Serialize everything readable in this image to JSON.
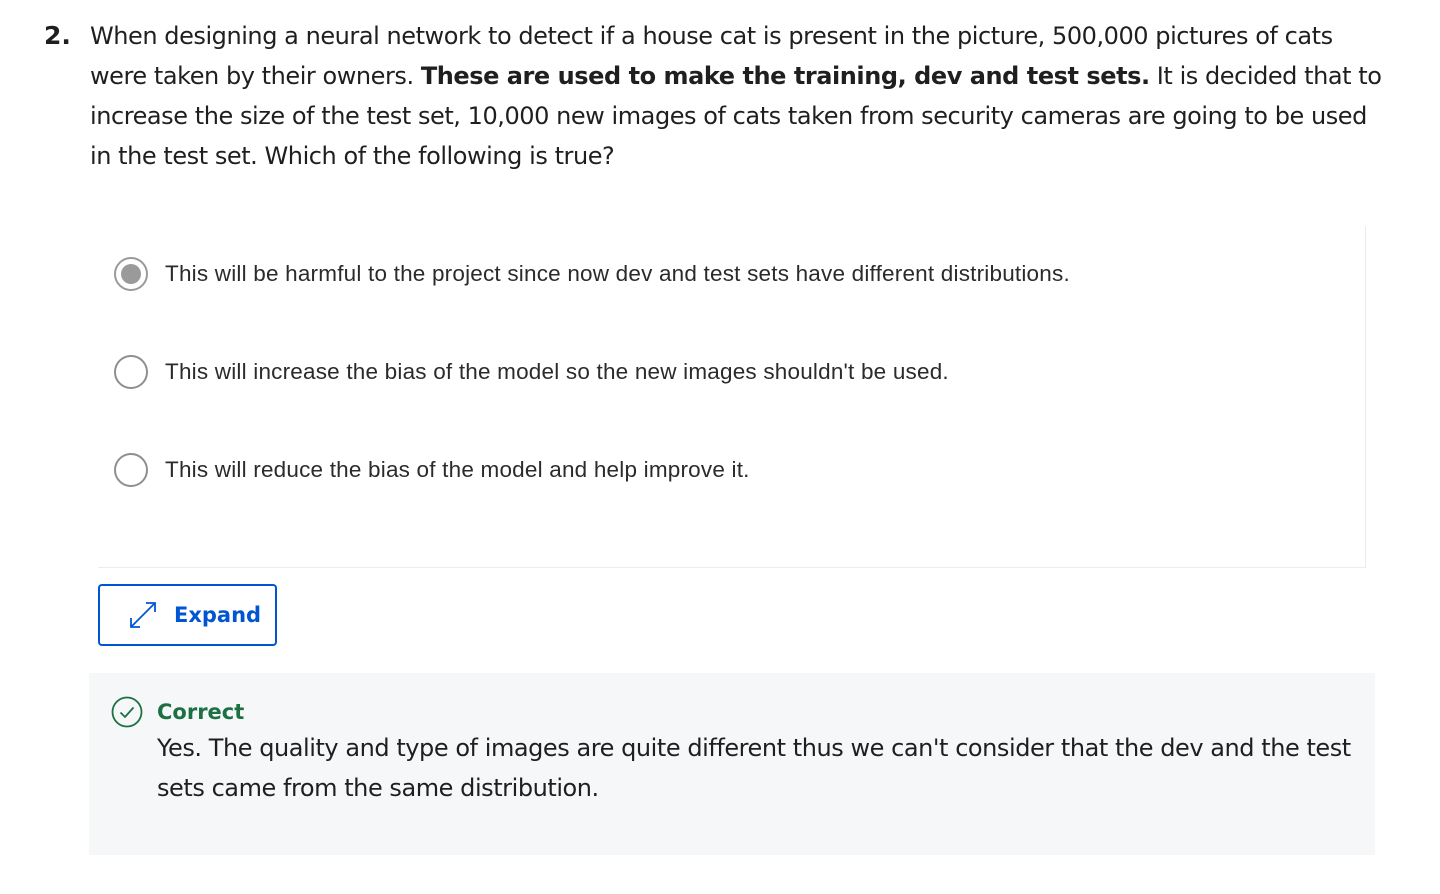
{
  "question": {
    "number": "2.",
    "text_before_bold": "When designing a neural network to detect if a house cat is present in the picture, 500,000 pictures of cats were taken by their owners. ",
    "text_bold": "These are used to make the training, dev and test sets.",
    "text_after_bold": " It is decided that to increase the size of the test set, 10,000 new images of cats taken from security cameras are going to be used in the test set. Which of the following is true?"
  },
  "options": [
    {
      "label": "This will be harmful to the project since now dev and test sets have different distributions.",
      "selected": true
    },
    {
      "label": "This will increase the bias of the model so the new images shouldn't be used.",
      "selected": false
    },
    {
      "label": "This will reduce the bias of the model and help improve it.",
      "selected": false
    }
  ],
  "expand_button": {
    "label": "Expand",
    "icon": "expand-arrows-icon"
  },
  "feedback": {
    "icon": "check-circle-icon",
    "status": "Correct",
    "text": "Yes. The quality and type of images are quite different thus we can't consider that the dev and the test sets came from the same distribution."
  },
  "colors": {
    "accent": "#0056d2",
    "correct": "#1d7044",
    "feedback_bg": "#f5f7f8",
    "radio_selected": "#9a9a9a"
  }
}
